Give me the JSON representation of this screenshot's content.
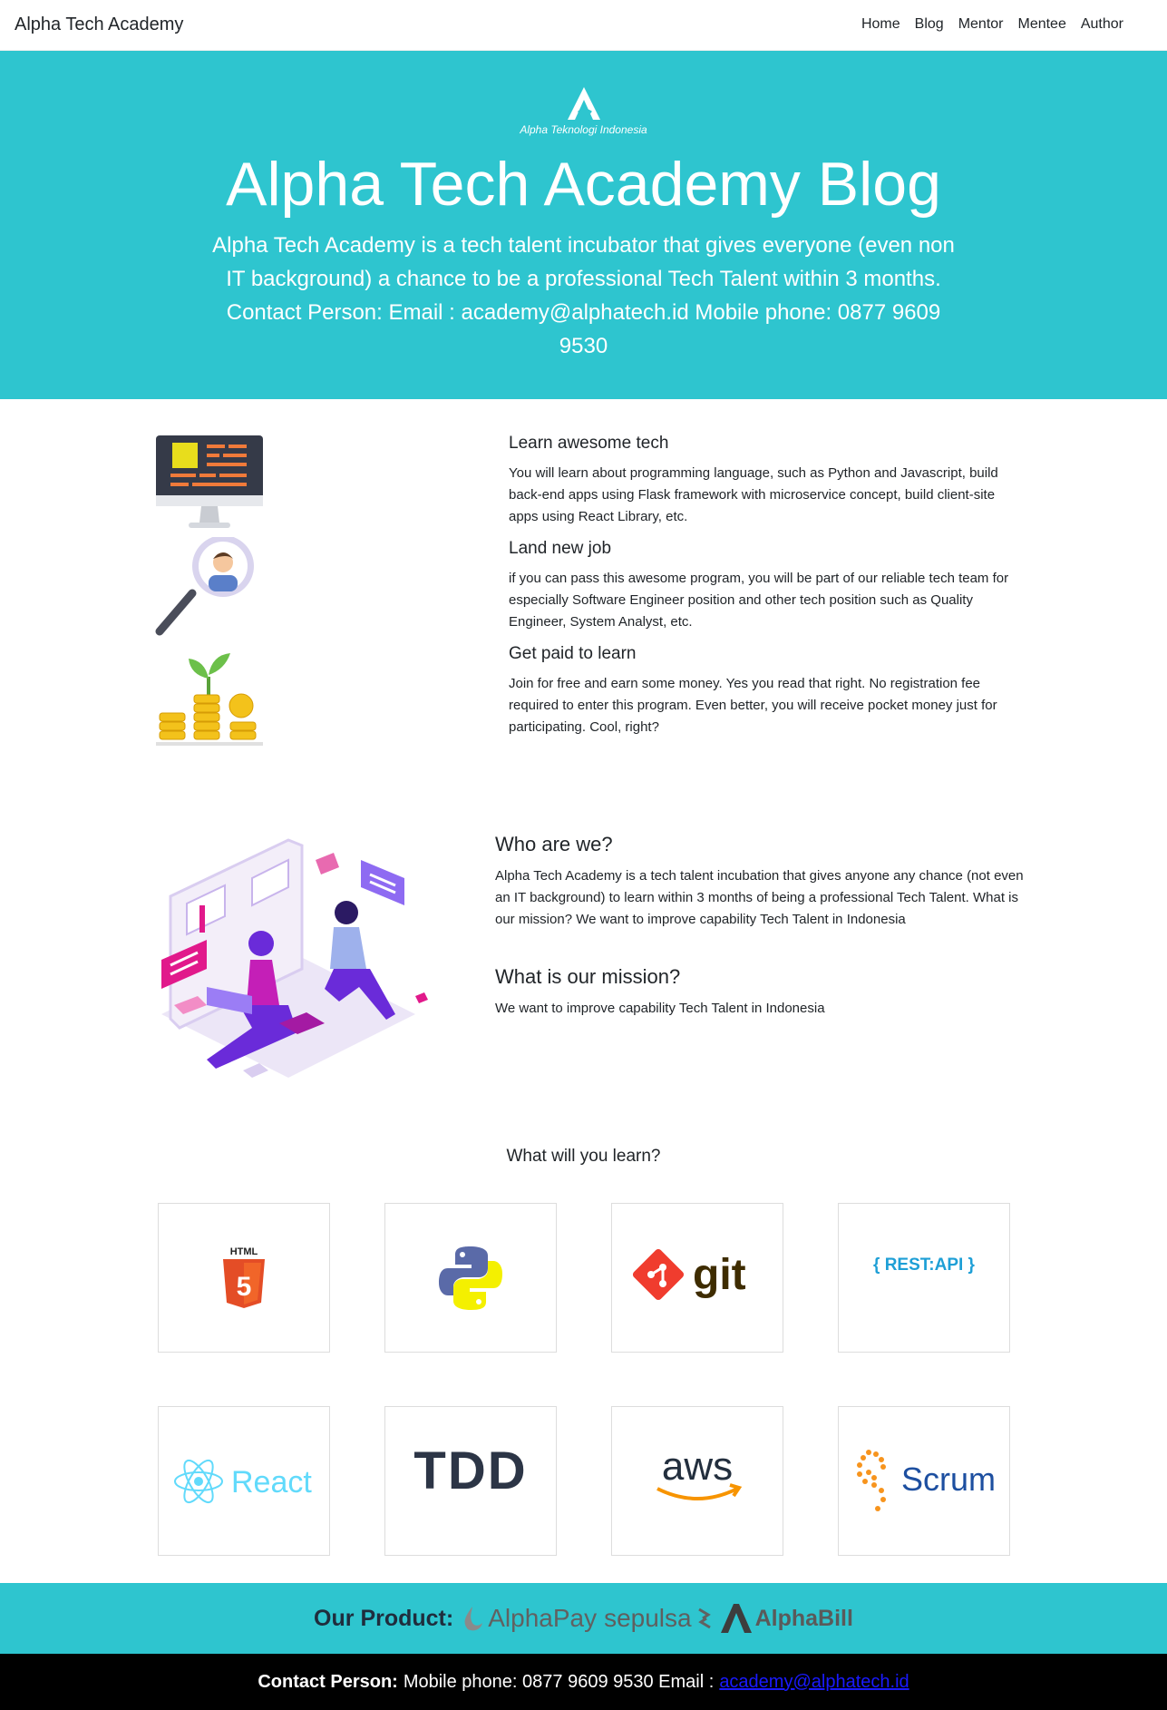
{
  "navbar": {
    "brand": "Alpha Tech Academy",
    "links": [
      "Home",
      "Blog",
      "Mentor",
      "Mentee",
      "Author"
    ]
  },
  "hero": {
    "logo_text": "Alpha Teknologi Indonesia",
    "title": "Alpha Tech Academy Blog",
    "description": "Alpha Tech Academy is a tech talent incubator that gives everyone (even non IT background) a chance to be a professional Tech Talent within 3 months. Contact Person: Email : academy@alphatech.id Mobile phone: 0877 9609 9530"
  },
  "features": [
    {
      "title": "Learn awesome tech",
      "text": "You will learn about programming language, such as Python and Javascript, build back-end apps using Flask framework with microservice concept, build client-site apps using React Library, etc."
    },
    {
      "title": "Land new job",
      "text": "if you can pass this awesome program, you will be part of our reliable tech team for especially Software Engineer position and other tech position such as Quality Engineer, System Analyst, etc."
    },
    {
      "title": "Get paid to learn",
      "text": "Join for free and earn some money. Yes you read that right. No registration fee required to enter this program. Even better, you will receive pocket money just for participating. Cool, right?"
    }
  ],
  "about": {
    "who_title": "Who are we?",
    "who_text": "Alpha Tech Academy is a tech talent incubation that gives anyone any chance (not even an IT background) to learn within 3 months of being a professional Tech Talent. What is our mission? We want to improve capability Tech Talent in Indonesia",
    "mission_title": "What is our mission?",
    "mission_text": "We want to improve capability Tech Talent in Indonesia"
  },
  "learn": {
    "title": "What will you learn?",
    "html_label": "HTML",
    "html_num": "5",
    "git_label": "git",
    "rest_label": "{ REST:API }",
    "react_label": "React",
    "tdd_label": "TDD",
    "aws_label": "aws",
    "scrum_label": "Scrum"
  },
  "product": {
    "label": "Our Product:",
    "items": [
      "AlphaPay",
      "sepulsa",
      "AlphaBill"
    ]
  },
  "footer": {
    "label": "Contact Person:",
    "text": "Mobile phone: 0877 9609 9530 Email :",
    "email": "academy@alphatech.id"
  },
  "colors": {
    "teal": "#2ec5cf",
    "footer_bg": "#000000",
    "link": "#1a1aff"
  }
}
